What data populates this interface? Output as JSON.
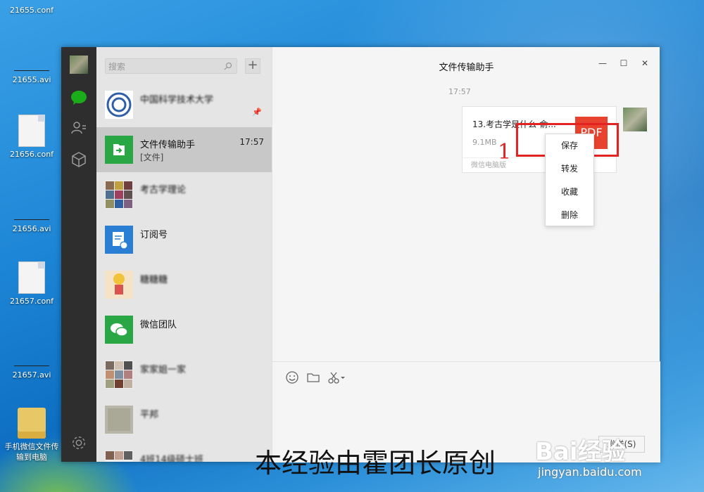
{
  "desktop": {
    "icons": [
      {
        "label": "21655.conf"
      },
      {
        "label": "21655.avi"
      },
      {
        "label": "21656.conf"
      },
      {
        "label": "21656.avi"
      },
      {
        "label": "21657.conf"
      },
      {
        "label": "21657.avi"
      },
      {
        "label": "手机微信文件传输到电脑"
      }
    ]
  },
  "search": {
    "placeholder": "搜索"
  },
  "chats": [
    {
      "name": "中国科学技术大学",
      "sub": "",
      "time": ""
    },
    {
      "name": "文件传输助手",
      "sub": "[文件]",
      "time": "17:57"
    },
    {
      "name": "考古学理论",
      "sub": "",
      "time": ""
    },
    {
      "name": "订阅号",
      "sub": "",
      "time": ""
    },
    {
      "name": "糖糖糖",
      "sub": "",
      "time": ""
    },
    {
      "name": "微信团队",
      "sub": "",
      "time": ""
    },
    {
      "name": "家家姐一家",
      "sub": "",
      "time": ""
    },
    {
      "name": "平邦",
      "sub": "",
      "time": ""
    },
    {
      "name": "4班14级硕士班",
      "sub": "",
      "time": ""
    }
  ],
  "conversation": {
    "title": "文件传输助手",
    "timestamp": "17:57",
    "file": {
      "name": "13.考古学是什么-俞...",
      "size": "9.1MB",
      "type": "PDF",
      "source": "微信电脑版"
    }
  },
  "context_menu": {
    "items": [
      "保存",
      "转发",
      "收藏",
      "删除"
    ]
  },
  "annotation": {
    "number": "1"
  },
  "composer": {
    "send_label": "发送(S)"
  },
  "watermark": {
    "text": "本经验由霍团长原创"
  },
  "brand": {
    "logo_text": "Bai经验",
    "url": "jingyan.baidu.com"
  },
  "colors": {
    "accent_green": "#1aad19",
    "pdf_red": "#e8432e",
    "highlight_red": "#e32222"
  }
}
